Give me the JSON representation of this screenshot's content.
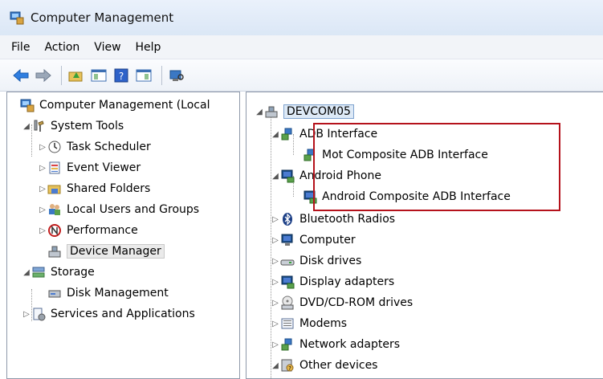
{
  "window": {
    "title": "Computer Management"
  },
  "menu": [
    "File",
    "Action",
    "View",
    "Help"
  ],
  "left_tree": [
    {
      "label": "Computer Management (Local",
      "icon": "computer-management-icon",
      "level": 0,
      "arrow": "",
      "selected": false
    },
    {
      "label": "System Tools",
      "icon": "system-tools-icon",
      "level": 1,
      "arrow": "expanded",
      "selected": false
    },
    {
      "label": "Task Scheduler",
      "icon": "clock-icon",
      "level": 2,
      "arrow": "collapsed",
      "selected": false
    },
    {
      "label": "Event Viewer",
      "icon": "event-viewer-icon",
      "level": 2,
      "arrow": "collapsed",
      "selected": false
    },
    {
      "label": "Shared Folders",
      "icon": "shared-folder-icon",
      "level": 2,
      "arrow": "collapsed",
      "selected": false
    },
    {
      "label": "Local Users and Groups",
      "icon": "users-icon",
      "level": 2,
      "arrow": "collapsed",
      "selected": false
    },
    {
      "label": "Performance",
      "icon": "performance-icon",
      "level": 2,
      "arrow": "collapsed",
      "selected": false
    },
    {
      "label": "Device Manager",
      "icon": "device-manager-icon",
      "level": 2,
      "arrow": "",
      "selected": true
    },
    {
      "label": "Storage",
      "icon": "storage-icon",
      "level": 1,
      "arrow": "expanded",
      "selected": false
    },
    {
      "label": "Disk Management",
      "icon": "disk-management-icon",
      "level": 2,
      "arrow": "",
      "selected": false
    },
    {
      "label": "Services and Applications",
      "icon": "services-icon",
      "level": 1,
      "arrow": "collapsed",
      "selected": false
    }
  ],
  "device_tree": [
    {
      "label": "DEVCOM05",
      "icon": "computer-icon",
      "level": 0,
      "arrow": "expanded",
      "selected": true
    },
    {
      "label": "ADB Interface",
      "icon": "adb-interface-icon",
      "level": 1,
      "arrow": "expanded",
      "selected": false
    },
    {
      "label": "Mot Composite ADB Interface",
      "icon": "adb-device-icon",
      "level": 2,
      "arrow": "",
      "selected": false
    },
    {
      "label": "Android Phone",
      "icon": "android-phone-icon",
      "level": 1,
      "arrow": "expanded",
      "selected": false
    },
    {
      "label": "Android Composite ADB Interface",
      "icon": "android-device-icon",
      "level": 2,
      "arrow": "",
      "selected": false
    },
    {
      "label": "Bluetooth Radios",
      "icon": "bluetooth-icon",
      "level": 1,
      "arrow": "collapsed",
      "selected": false
    },
    {
      "label": "Computer",
      "icon": "computer-monitor-icon",
      "level": 1,
      "arrow": "collapsed",
      "selected": false
    },
    {
      "label": "Disk drives",
      "icon": "disk-drive-icon",
      "level": 1,
      "arrow": "collapsed",
      "selected": false
    },
    {
      "label": "Display adapters",
      "icon": "display-adapter-icon",
      "level": 1,
      "arrow": "collapsed",
      "selected": false
    },
    {
      "label": "DVD/CD-ROM drives",
      "icon": "dvd-drive-icon",
      "level": 1,
      "arrow": "collapsed",
      "selected": false
    },
    {
      "label": "Modems",
      "icon": "modem-icon",
      "level": 1,
      "arrow": "collapsed",
      "selected": false
    },
    {
      "label": "Network adapters",
      "icon": "network-adapter-icon",
      "level": 1,
      "arrow": "collapsed",
      "selected": false
    },
    {
      "label": "Other devices",
      "icon": "other-devices-icon",
      "level": 1,
      "arrow": "expanded",
      "selected": false
    }
  ],
  "colors": {
    "highlight_box": "#b5121b",
    "selection": "#dde9f6"
  }
}
